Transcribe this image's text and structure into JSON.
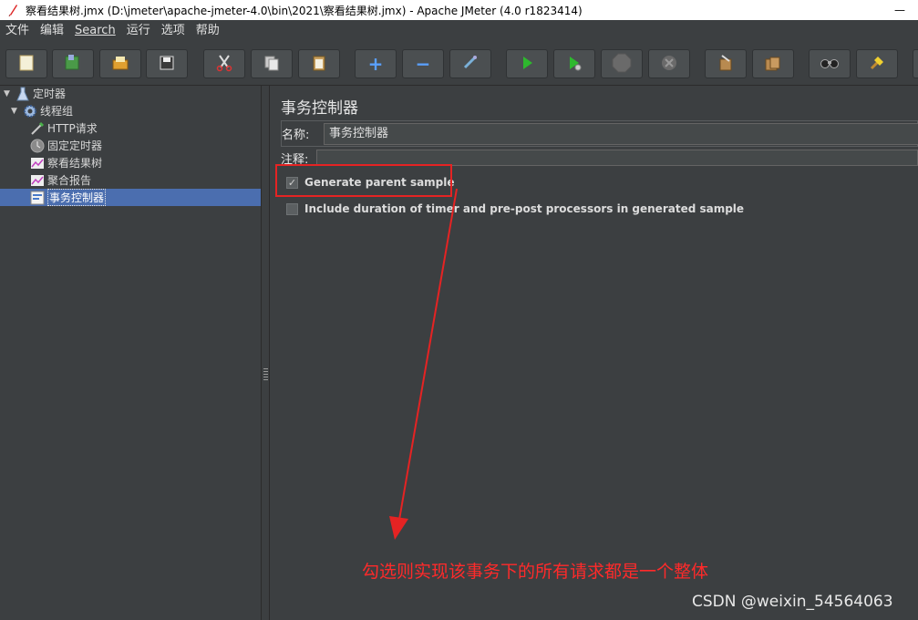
{
  "window": {
    "title": "察看结果树.jmx (D:\\jmeter\\apache-jmeter-4.0\\bin\\2021\\察看结果树.jmx) - Apache JMeter (4.0 r1823414)",
    "minimize": "—"
  },
  "menu": [
    "文件",
    "编辑",
    "Search",
    "运行",
    "选项",
    "帮助"
  ],
  "toolbar": {
    "icons": [
      "new-icon",
      "templates-icon",
      "open-icon",
      "save-icon",
      "cut-icon",
      "copy-icon",
      "paste-icon",
      "expand-icon",
      "collapse-icon",
      "toggle-icon",
      "start-icon",
      "start-no-pauses-icon",
      "stop-icon",
      "shutdown-icon",
      "clear-icon",
      "clear-all-icon",
      "search-icon",
      "reset-search-icon"
    ],
    "expand_symbol": "+",
    "collapse_symbol": "−"
  },
  "tree": [
    {
      "label": "定时器",
      "icon": "test-plan-icon",
      "expanded": true
    },
    {
      "label": "线程组",
      "icon": "thread-group-icon",
      "expanded": true
    },
    {
      "label": "HTTP请求",
      "icon": "sampler-icon"
    },
    {
      "label": "固定定时器",
      "icon": "timer-icon"
    },
    {
      "label": "察看结果树",
      "icon": "listener-icon"
    },
    {
      "label": "聚合报告",
      "icon": "listener-icon"
    },
    {
      "label": "事务控制器",
      "icon": "controller-icon",
      "selected": true
    }
  ],
  "panel": {
    "title": "事务控制器",
    "name_label": "名称:",
    "name_value": "事务控制器",
    "comment_label": "注释:",
    "generate_parent_label": "Generate parent sample",
    "generate_parent_checked": true,
    "include_duration_label": "Include duration of timer and pre-post processors in generated sample",
    "include_duration_checked": false
  },
  "annotation": "勾选则实现该事务下的所有请求都是一个整体",
  "watermark": "CSDN @weixin_54564063",
  "colors": {
    "background": "#3c3f41",
    "selection": "#4b6eaf",
    "annotation": "#e52323"
  }
}
